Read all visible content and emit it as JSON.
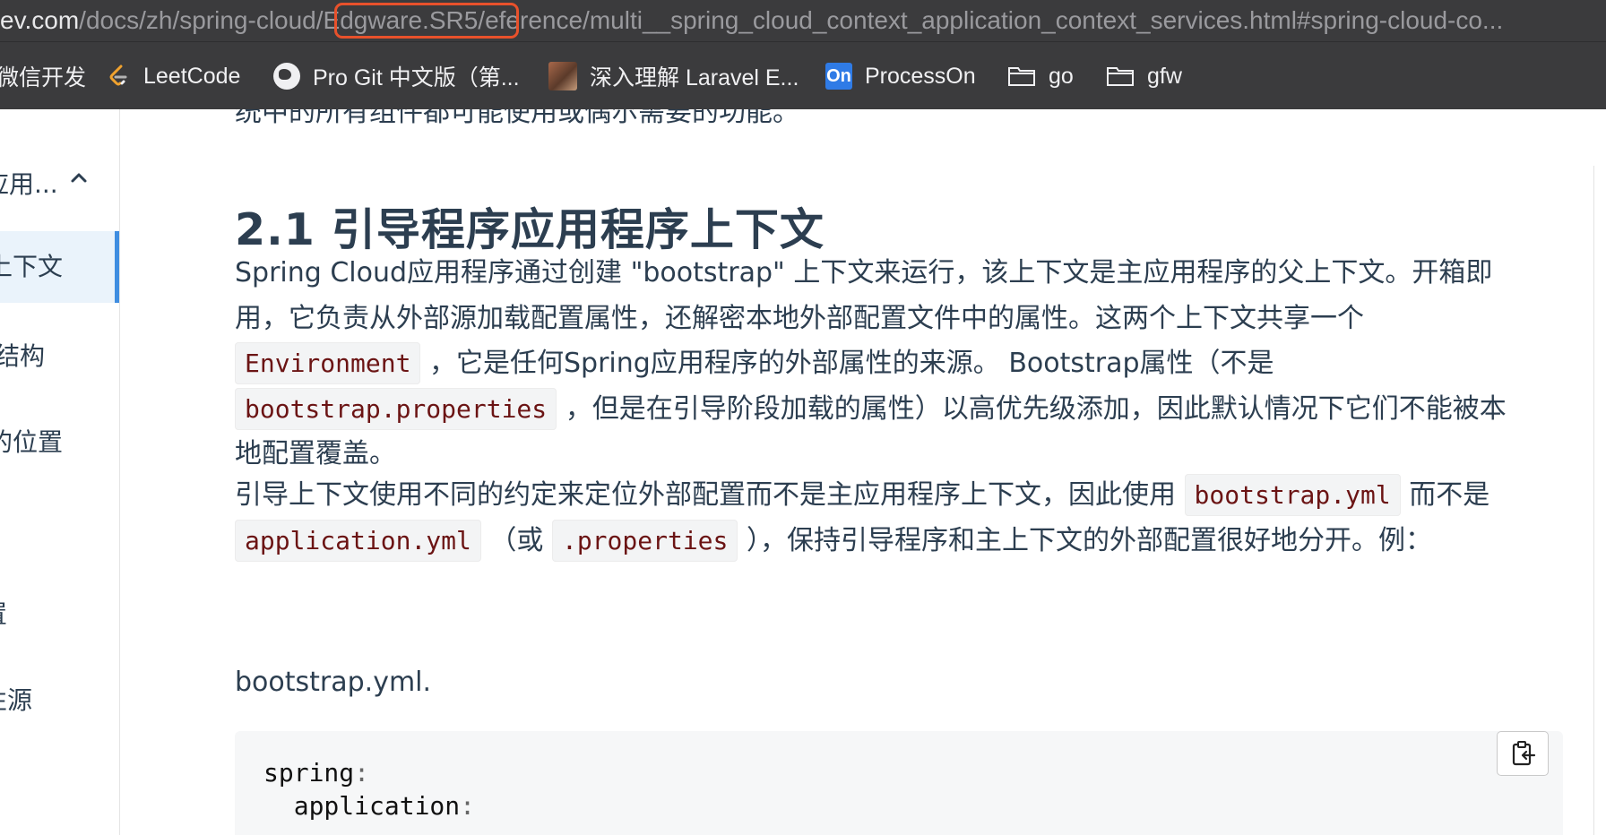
{
  "address_bar": {
    "host": "ev.com",
    "path_before": "/docs/zh/spring-cloud",
    "highlighted": "/Edgware.SR5/",
    "path_after": "eference/multi__spring_cloud_context_application_context_services.html#spring-cloud-co..."
  },
  "bookmarks": [
    {
      "label": "微信开发",
      "icon": "none"
    },
    {
      "label": "LeetCode",
      "icon": "leetcode-icon"
    },
    {
      "label": "Pro Git 中文版（第...",
      "icon": "globe-icon"
    },
    {
      "label": "深入理解 Laravel E...",
      "icon": "avatar-icon"
    },
    {
      "label": "ProcessOn",
      "icon": "processon-icon"
    },
    {
      "label": "go",
      "icon": "folder-icon"
    },
    {
      "label": "gfw",
      "icon": "folder-icon"
    }
  ],
  "processon_icon_text": "On",
  "sidebar": {
    "items": [
      {
        "label": "应用..."
      },
      {
        "label": "上下文"
      },
      {
        "label": "结构"
      },
      {
        "label": "的位置"
      },
      {
        "label": "置"
      },
      {
        "label": "性源"
      }
    ]
  },
  "content": {
    "cut_line": "统中的所有组件都可能使用或偶尔需要的功能。",
    "heading": "2.1 引导程序应用程序上下文",
    "p1": {
      "a": "Spring Cloud应用程序通过创建 \"bootstrap\" 上下文来运行，该上下文是主应用程序的父上下文。开箱即用，它负责从外部源加载配置属性，还解密本地外部配置文件中的属性。这两个上下文共享一个",
      "code1": "Environment",
      "b": "，它是任何Spring应用程序的外部属性的来源。 Bootstrap属性（不是",
      "code2": "bootstrap.properties",
      "c": "，但是在引导阶段加载的属性）以高优先级添加，因此默认情况下它们不能被本地配置覆盖。"
    },
    "p2": {
      "a": "引导上下文使用不同的约定来定位外部配置而不是主应用程序上下文，因此使用",
      "code1": "bootstrap.yml",
      "b": "而不是",
      "code2": "application.yml",
      "c": "（或",
      "code3": ".properties",
      "d": "），保持引导程序和主上下文的外部配置很好地分开。例："
    },
    "label": "bootstrap.yml.",
    "code": {
      "line1_key": "spring",
      "line2_key": "  application",
      "colon": ":"
    }
  },
  "colors": {
    "chrome": "#3b3b3d",
    "highlight_border": "#e8512b",
    "active_sidebar": "#3f8de0",
    "code_text": "#6b1414"
  }
}
